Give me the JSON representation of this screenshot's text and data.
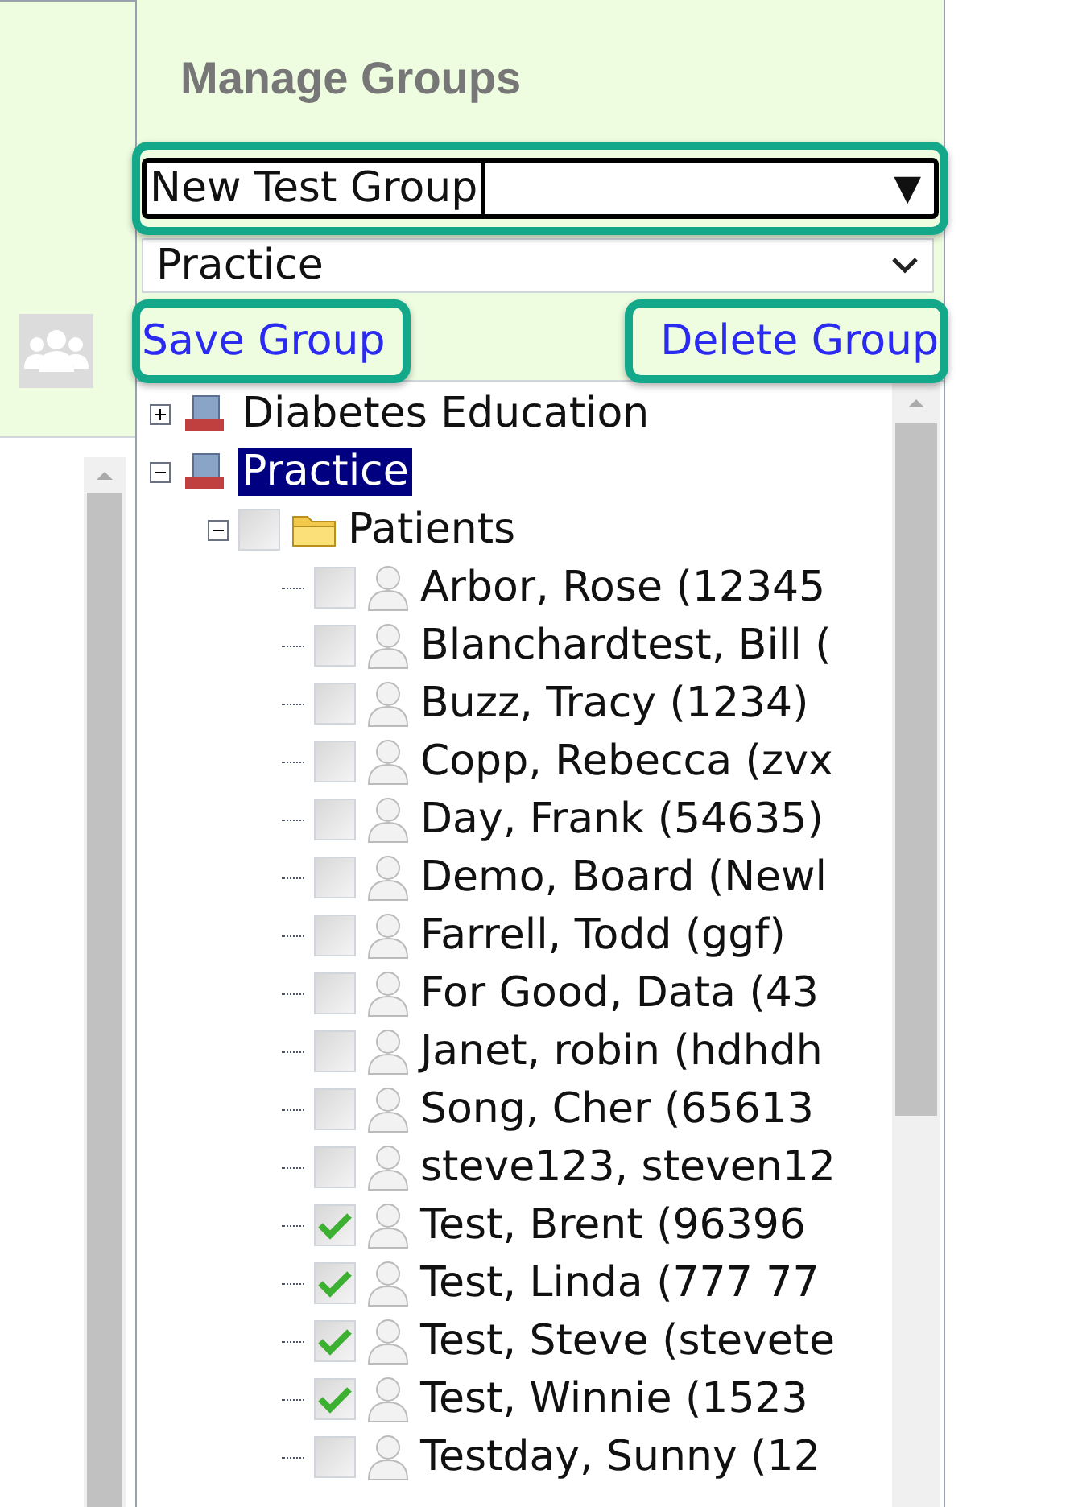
{
  "title": "Manage Groups",
  "group_combo": {
    "value": "New Test Group",
    "arrow": "▼"
  },
  "practice_select": {
    "value": "Practice"
  },
  "links": [
    "Save Group",
    "Delete Group"
  ],
  "tree": [
    {
      "label": "Diabetes Education",
      "kind": "practice",
      "expanded": false,
      "selected": false
    },
    {
      "label": "Practice",
      "kind": "practice",
      "expanded": true,
      "selected": true,
      "children": [
        {
          "label": "Patients",
          "kind": "folder",
          "expanded": true,
          "checked": false,
          "children": [
            {
              "label": "Arbor, Rose (12345",
              "kind": "patient",
              "checked": false
            },
            {
              "label": "Blanchardtest, Bill (",
              "kind": "patient",
              "checked": false
            },
            {
              "label": "Buzz, Tracy (1234)",
              "kind": "patient",
              "checked": false
            },
            {
              "label": "Copp, Rebecca (zvx",
              "kind": "patient",
              "checked": false
            },
            {
              "label": "Day, Frank (54635)",
              "kind": "patient",
              "checked": false
            },
            {
              "label": "Demo, Board (Newl",
              "kind": "patient",
              "checked": false
            },
            {
              "label": "Farrell, Todd (ggf)",
              "kind": "patient",
              "checked": false
            },
            {
              "label": "For Good, Data (43",
              "kind": "patient",
              "checked": false
            },
            {
              "label": "Janet, robin (hdhdh",
              "kind": "patient",
              "checked": false
            },
            {
              "label": "Song, Cher (65613",
              "kind": "patient",
              "checked": false
            },
            {
              "label": "steve123, steven12",
              "kind": "patient",
              "checked": false
            },
            {
              "label": "Test, Brent (96396",
              "kind": "patient",
              "checked": true
            },
            {
              "label": "Test, Linda (777 77",
              "kind": "patient",
              "checked": true
            },
            {
              "label": "Test, Steve (stevete",
              "kind": "patient",
              "checked": true
            },
            {
              "label": "Test, Winnie (1523",
              "kind": "patient",
              "checked": true
            },
            {
              "label": "Testday, Sunny (12",
              "kind": "patient",
              "checked": false
            }
          ]
        }
      ]
    }
  ]
}
